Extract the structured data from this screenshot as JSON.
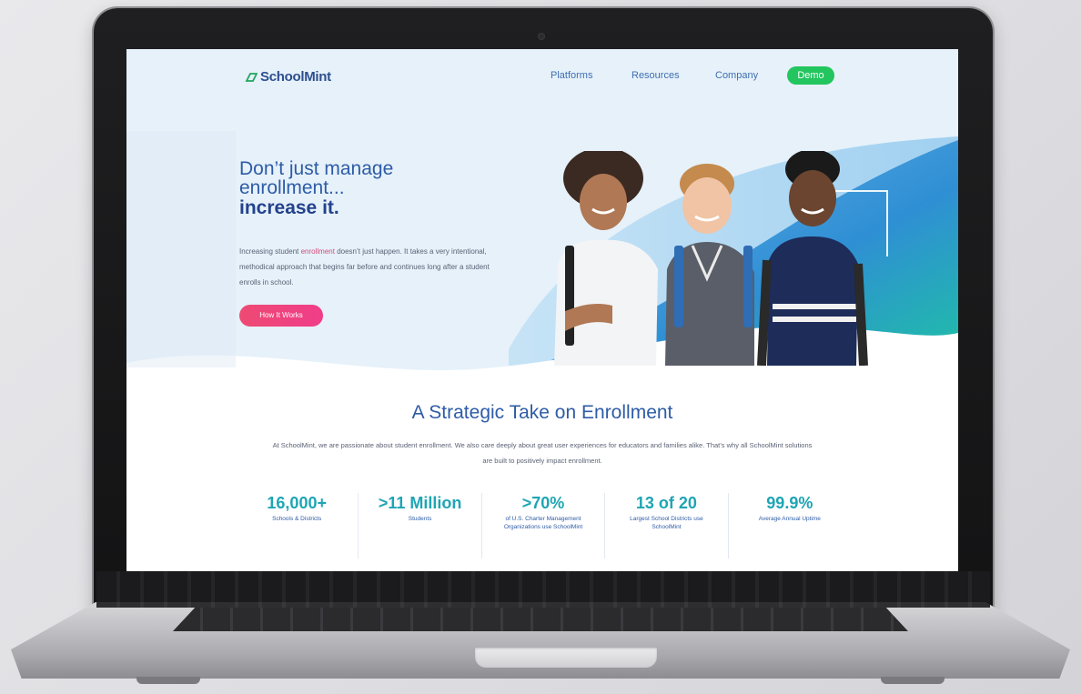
{
  "nav": {
    "logo": "SchoolMint",
    "links": [
      "Platforms",
      "Resources",
      "Company"
    ],
    "demo_label": "Demo"
  },
  "hero": {
    "headline_line1": "Don’t just manage",
    "headline_line2": "enrollment...",
    "headline_strong": "increase it.",
    "body_before": "Increasing student ",
    "body_highlight": "enrollment",
    "body_after": " doesn’t just happen. It takes a very intentional, methodical approach that begins far before and continues long after a student enrolls in school.",
    "cta_label": "How It Works"
  },
  "section": {
    "title": "A Strategic Take on Enrollment",
    "body": "At SchoolMint, we are passionate about student enrollment.  We also care deeply about great user experiences for educators and families alike. That’s why all SchoolMint solutions are built to positively impact enrollment."
  },
  "stats": [
    {
      "value": "16,000+",
      "label": "Schools & Districts"
    },
    {
      "value": ">11 Million",
      "label": "Students"
    },
    {
      "value": ">70%",
      "label": "of U.S. Charter Management Organizations use SchoolMint"
    },
    {
      "value": "13 of 20",
      "label": "Largest School Districts use SchoolMint"
    },
    {
      "value": "99.9%",
      "label": "Average Annual Uptime"
    }
  ],
  "colors": {
    "brand_blue": "#2e5ca6",
    "stat_teal": "#1ea5b4",
    "demo_green": "#22c55e",
    "cta_pink": "#ee4a73"
  }
}
